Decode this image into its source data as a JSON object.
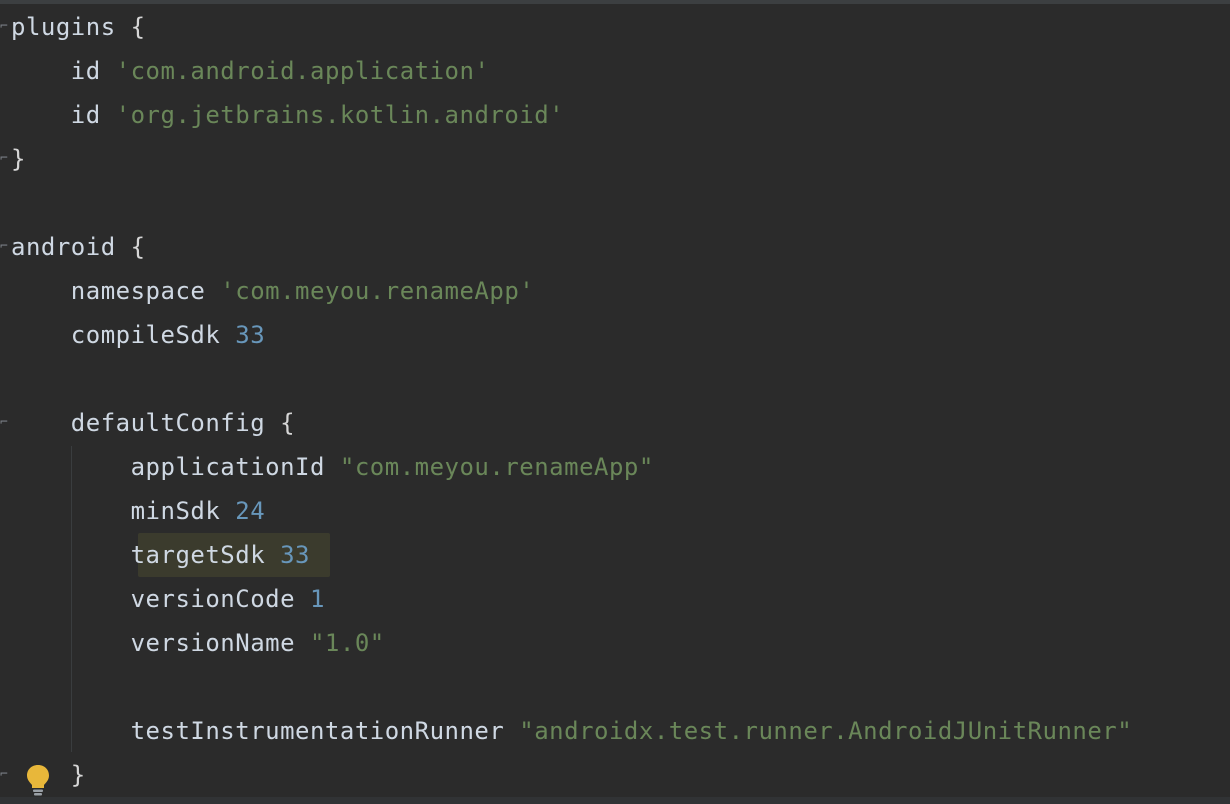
{
  "editor": {
    "lines": [
      {
        "id": "l1",
        "tokens": [
          {
            "t": "plugins ",
            "c": "kw"
          },
          {
            "t": "{",
            "c": "brace"
          }
        ]
      },
      {
        "id": "l2",
        "tokens": [
          {
            "t": "    id ",
            "c": "kw"
          },
          {
            "t": "'com.android.application'",
            "c": "str"
          }
        ]
      },
      {
        "id": "l3",
        "tokens": [
          {
            "t": "    id ",
            "c": "kw"
          },
          {
            "t": "'org.jetbrains.kotlin.android'",
            "c": "str"
          }
        ]
      },
      {
        "id": "l4",
        "tokens": [
          {
            "t": "}",
            "c": "brace"
          }
        ]
      },
      {
        "id": "l5",
        "tokens": []
      },
      {
        "id": "l6",
        "tokens": [
          {
            "t": "android ",
            "c": "kw"
          },
          {
            "t": "{",
            "c": "brace"
          }
        ]
      },
      {
        "id": "l7",
        "tokens": [
          {
            "t": "    namespace ",
            "c": "kw"
          },
          {
            "t": "'com.meyou.renameApp'",
            "c": "str"
          }
        ]
      },
      {
        "id": "l8",
        "tokens": [
          {
            "t": "    compileSdk ",
            "c": "kw"
          },
          {
            "t": "33",
            "c": "num"
          }
        ]
      },
      {
        "id": "l9",
        "tokens": []
      },
      {
        "id": "l10",
        "tokens": [
          {
            "t": "    defaultConfig ",
            "c": "kw"
          },
          {
            "t": "{",
            "c": "brace"
          }
        ]
      },
      {
        "id": "l11",
        "tokens": [
          {
            "t": "        applicationId ",
            "c": "kw"
          },
          {
            "t": "\"com.meyou.renameApp\"",
            "c": "str"
          }
        ]
      },
      {
        "id": "l12",
        "tokens": [
          {
            "t": "        minSdk ",
            "c": "kw"
          },
          {
            "t": "24",
            "c": "num"
          }
        ]
      },
      {
        "id": "l13",
        "tokens": [
          {
            "t": "        targetSdk ",
            "c": "kw"
          },
          {
            "t": "33",
            "c": "num"
          }
        ]
      },
      {
        "id": "l14",
        "tokens": [
          {
            "t": "        versionCode ",
            "c": "kw"
          },
          {
            "t": "1",
            "c": "num"
          }
        ]
      },
      {
        "id": "l15",
        "tokens": [
          {
            "t": "        versionName ",
            "c": "kw"
          },
          {
            "t": "\"1.0\"",
            "c": "str"
          }
        ]
      },
      {
        "id": "l16",
        "tokens": []
      },
      {
        "id": "l17",
        "tokens": [
          {
            "t": "        testInstrumentationRunner ",
            "c": "kw"
          },
          {
            "t": "\"androidx.test.runner.AndroidJUnitRunner\"",
            "c": "str"
          }
        ]
      },
      {
        "id": "l18",
        "tokens": [
          {
            "t": "    }",
            "c": "brace"
          }
        ]
      }
    ],
    "highlighted_line": "targetSdk 33",
    "intention_icon": "lightbulb-icon",
    "colors": {
      "background": "#2b2b2b",
      "string": "#6a8759",
      "number": "#6897bb",
      "identifier": "#cfd8e3",
      "highlight": "#3b3b2d",
      "bulb": "#e8b73a"
    }
  }
}
